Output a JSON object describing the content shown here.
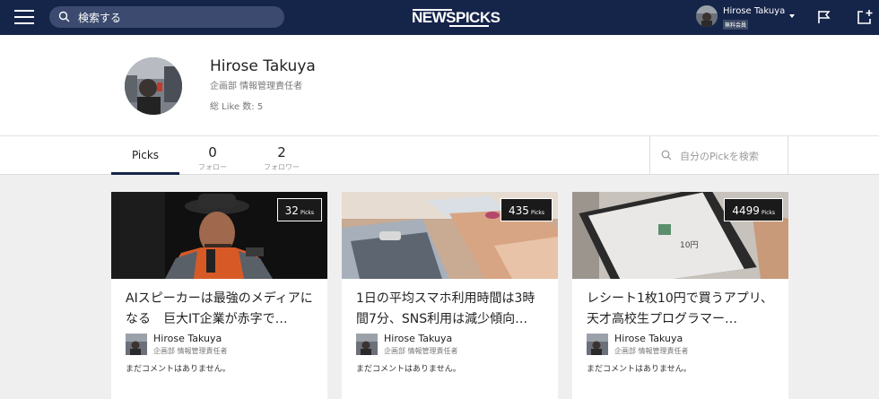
{
  "header": {
    "search_placeholder": "検索する",
    "logo": "NEWSPICKS",
    "user_name": "Hirose Takuya",
    "user_badge": "無料会員"
  },
  "profile": {
    "name": "Hirose Takuya",
    "title": "企画部 情報管理責任者",
    "likes": "総 Like 数:  5"
  },
  "tabs": {
    "picks_label": "Picks",
    "follow_count": "0",
    "follow_label": "フォロー",
    "follower_count": "2",
    "follower_label": "フォロワー",
    "search_placeholder": "自分のPickを検索"
  },
  "cards": [
    {
      "count": "32",
      "count_unit": "Picks",
      "title": "AIスピーカーは最強のメディアになる　巨大IT企業が赤字で…",
      "author": "Hirose Takuya",
      "author_title": "企画部 情報管理責任者",
      "comment": "まだコメントはありません。"
    },
    {
      "count": "435",
      "count_unit": "Picks",
      "title": "1日の平均スマホ利用時間は3時間7分、SNS利用は減少傾向…",
      "author": "Hirose Takuya",
      "author_title": "企画部 情報管理責任者",
      "comment": "まだコメントはありません。"
    },
    {
      "count": "4499",
      "count_unit": "Picks",
      "title": "レシート1枚10円で買うアプリ、天才高校生プログラマー…",
      "author": "Hirose Takuya",
      "author_title": "企画部 情報管理責任者",
      "comment": "まだコメントはありません。"
    }
  ],
  "colors": {
    "header_bg": "#152449",
    "page_bg": "#efefef",
    "accent": "#152449"
  }
}
